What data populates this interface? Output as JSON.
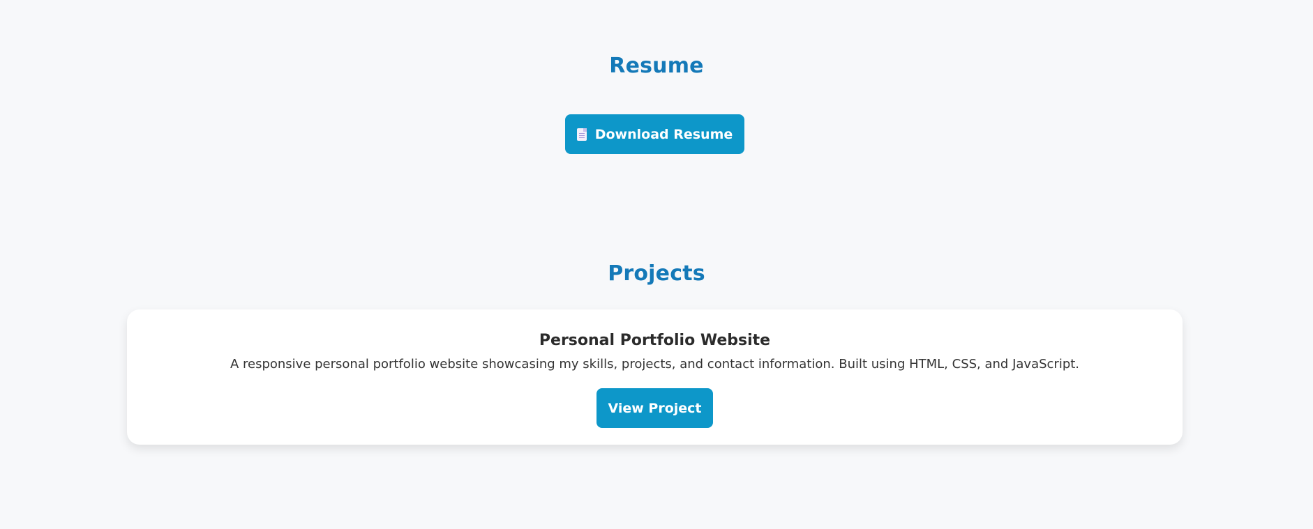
{
  "resume": {
    "title": "Resume",
    "download_button_label": "Download Resume",
    "download_button_icon": "document-icon"
  },
  "projects": {
    "title": "Projects",
    "items": [
      {
        "name": "Personal Portfolio Website",
        "description": "A responsive personal portfolio website showcasing my skills, projects, and contact information. Built using HTML, CSS, and JavaScript.",
        "button_label": "View Project"
      }
    ]
  },
  "colors": {
    "background": "#f7f8fa",
    "heading": "#1479b8",
    "button": "#0d97c9",
    "card": "#ffffff"
  }
}
